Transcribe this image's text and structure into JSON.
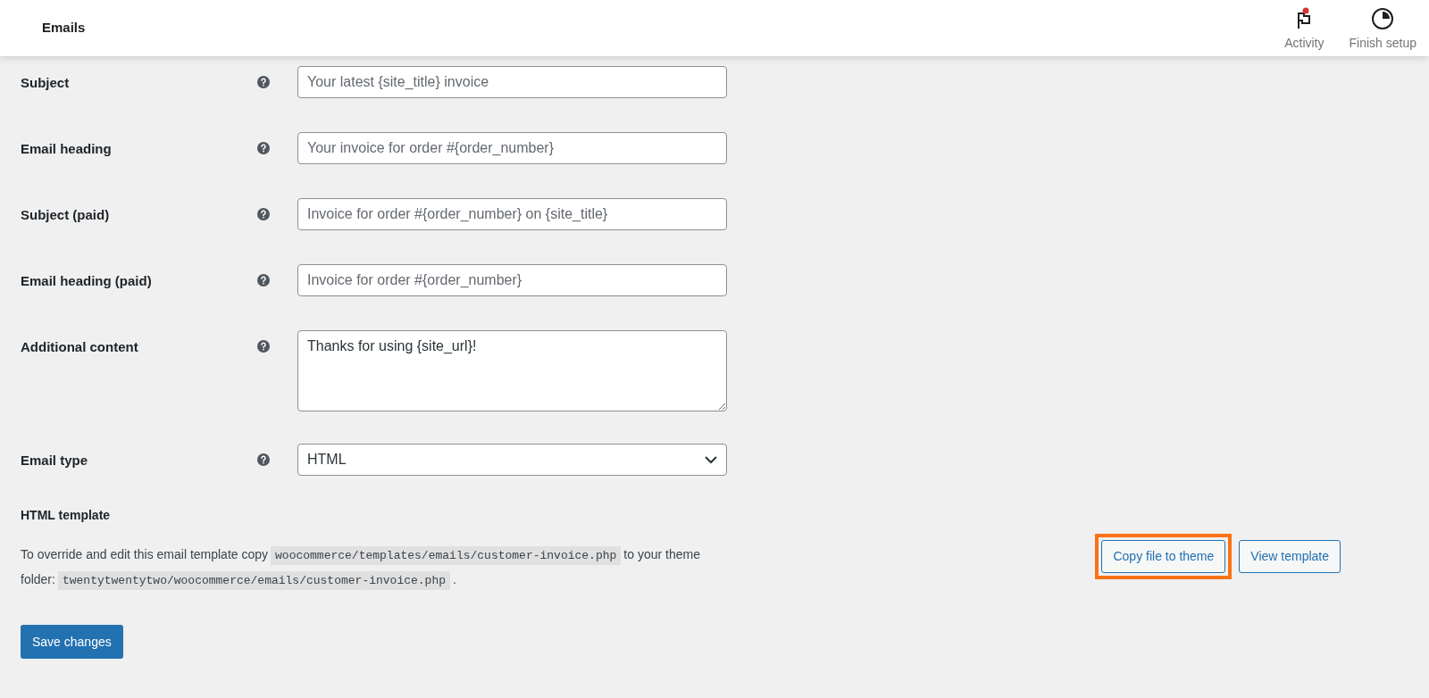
{
  "header": {
    "title": "Emails",
    "actions": [
      {
        "kind": "activity",
        "label": "Activity",
        "notification": true
      },
      {
        "kind": "setup",
        "label": "Finish setup",
        "notification": false
      }
    ]
  },
  "fields": [
    {
      "kind": "text",
      "label": "Subject",
      "placeholder": "Your latest {site_title} invoice"
    },
    {
      "kind": "text",
      "label": "Email heading",
      "placeholder": "Your invoice for order #{order_number}"
    },
    {
      "kind": "text",
      "label": "Subject (paid)",
      "placeholder": "Invoice for order #{order_number} on {site_title}"
    },
    {
      "kind": "text",
      "label": "Email heading (paid)",
      "placeholder": "Invoice for order #{order_number}"
    },
    {
      "kind": "textarea",
      "label": "Additional content",
      "value": "Thanks for using {site_url}!"
    },
    {
      "kind": "select",
      "label": "Email type",
      "value": "HTML"
    }
  ],
  "template": {
    "title": "HTML template",
    "description": [
      {
        "kind": "text",
        "text": "To override and edit this email template copy"
      },
      {
        "kind": "code",
        "text": "woocommerce/templates/emails/customer-invoice.php"
      },
      {
        "kind": "text",
        "text": "to your theme folder:"
      },
      {
        "kind": "code",
        "text": "twentytwentytwo/woocommerce/emails/customer-invoice.php"
      },
      {
        "kind": "text",
        "text": "."
      }
    ],
    "buttons": [
      {
        "label": "Copy file to theme",
        "highlighted": true
      },
      {
        "label": "View template",
        "highlighted": false
      }
    ]
  },
  "save_button": "Save changes"
}
